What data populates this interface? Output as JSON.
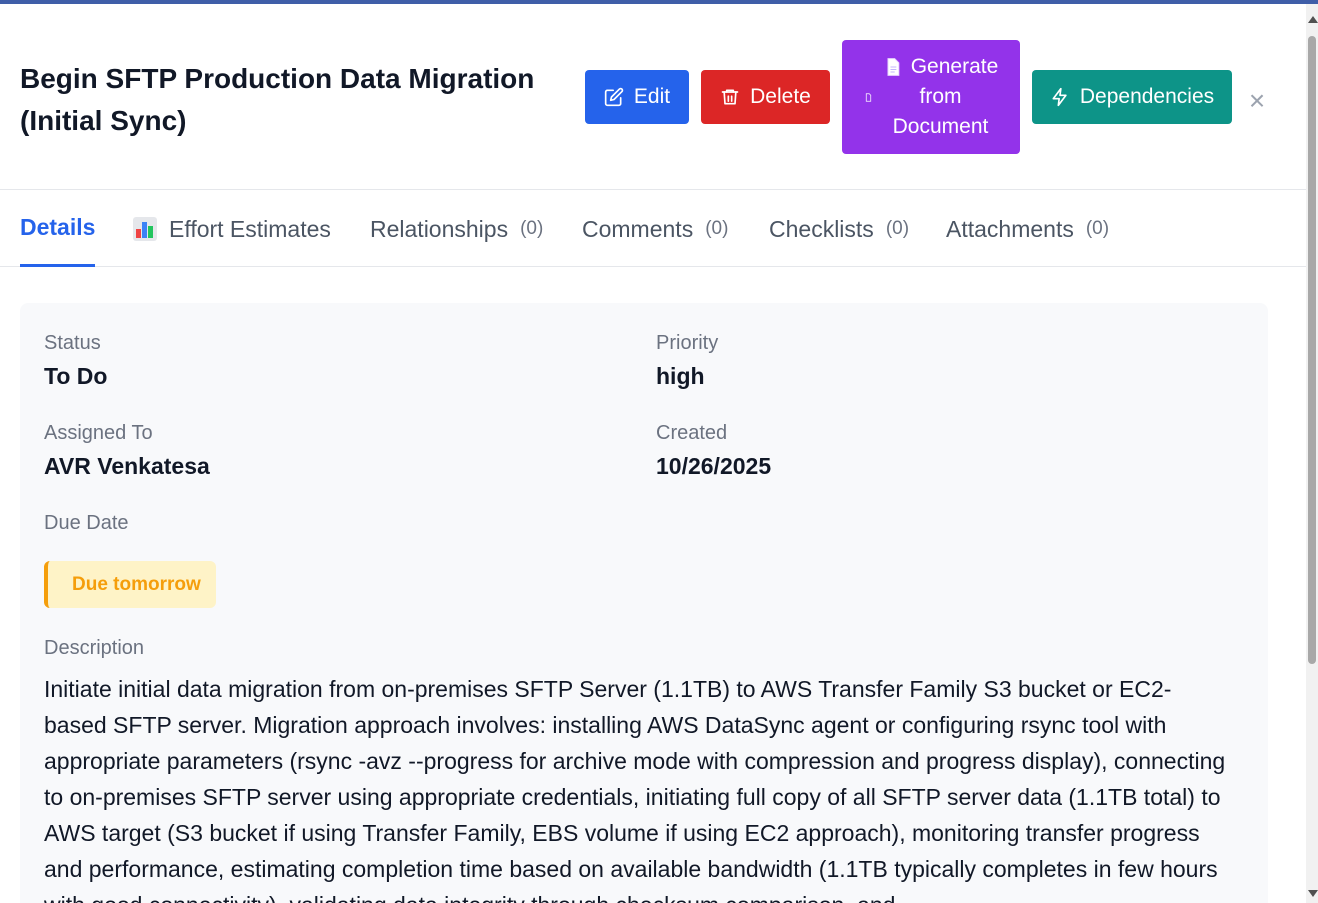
{
  "task": {
    "title": "Begin SFTP Production Data Migration (Initial Sync)"
  },
  "actions": {
    "edit_label": "Edit",
    "delete_label": "Delete",
    "generate_line1": "Generate",
    "generate_line2": "from",
    "generate_line3": "Document",
    "dependencies_label": "Dependencies",
    "close_glyph": "×"
  },
  "tabs": [
    {
      "label": "Details",
      "count": ""
    },
    {
      "label": "Effort Estimates",
      "count": ""
    },
    {
      "label": "Relationships",
      "count": "(0)"
    },
    {
      "label": "Comments",
      "count": "(0)"
    },
    {
      "label": "Checklists",
      "count": "(0)"
    },
    {
      "label": "Attachments",
      "count": "(0)"
    }
  ],
  "details": {
    "status_label": "Status",
    "status_value": "To Do",
    "priority_label": "Priority",
    "priority_value": "high",
    "assigned_label": "Assigned To",
    "assigned_value": "AVR Venkatesa",
    "created_label": "Created",
    "created_value": "10/26/2025",
    "due_label": "Due Date",
    "due_badge": "Due tomorrow",
    "description_label": "Description",
    "description": "Initiate initial data migration from on-premises SFTP Server (1.1TB) to AWS Transfer Family S3 bucket or EC2-based SFTP server. Migration approach involves: installing AWS DataSync agent or configuring rsync tool with appropriate parameters (rsync -avz --progress for archive mode with compression and progress display), connecting to on-premises SFTP server using appropriate credentials, initiating full copy of all SFTP server data (1.1TB total) to AWS target (S3 bucket if using Transfer Family, EBS volume if using EC2 approach), monitoring transfer progress and performance, estimating completion time based on available bandwidth (1.1TB typically completes in few hours with good connectivity), validating data integrity through checksum comparison, and"
  },
  "colors": {
    "edit": "#2563eb",
    "delete": "#dc2626",
    "generate": "#9333ea",
    "dependencies": "#0d9488",
    "due_badge_bg": "#fef3c7",
    "due_badge_text": "#f59e0b"
  }
}
